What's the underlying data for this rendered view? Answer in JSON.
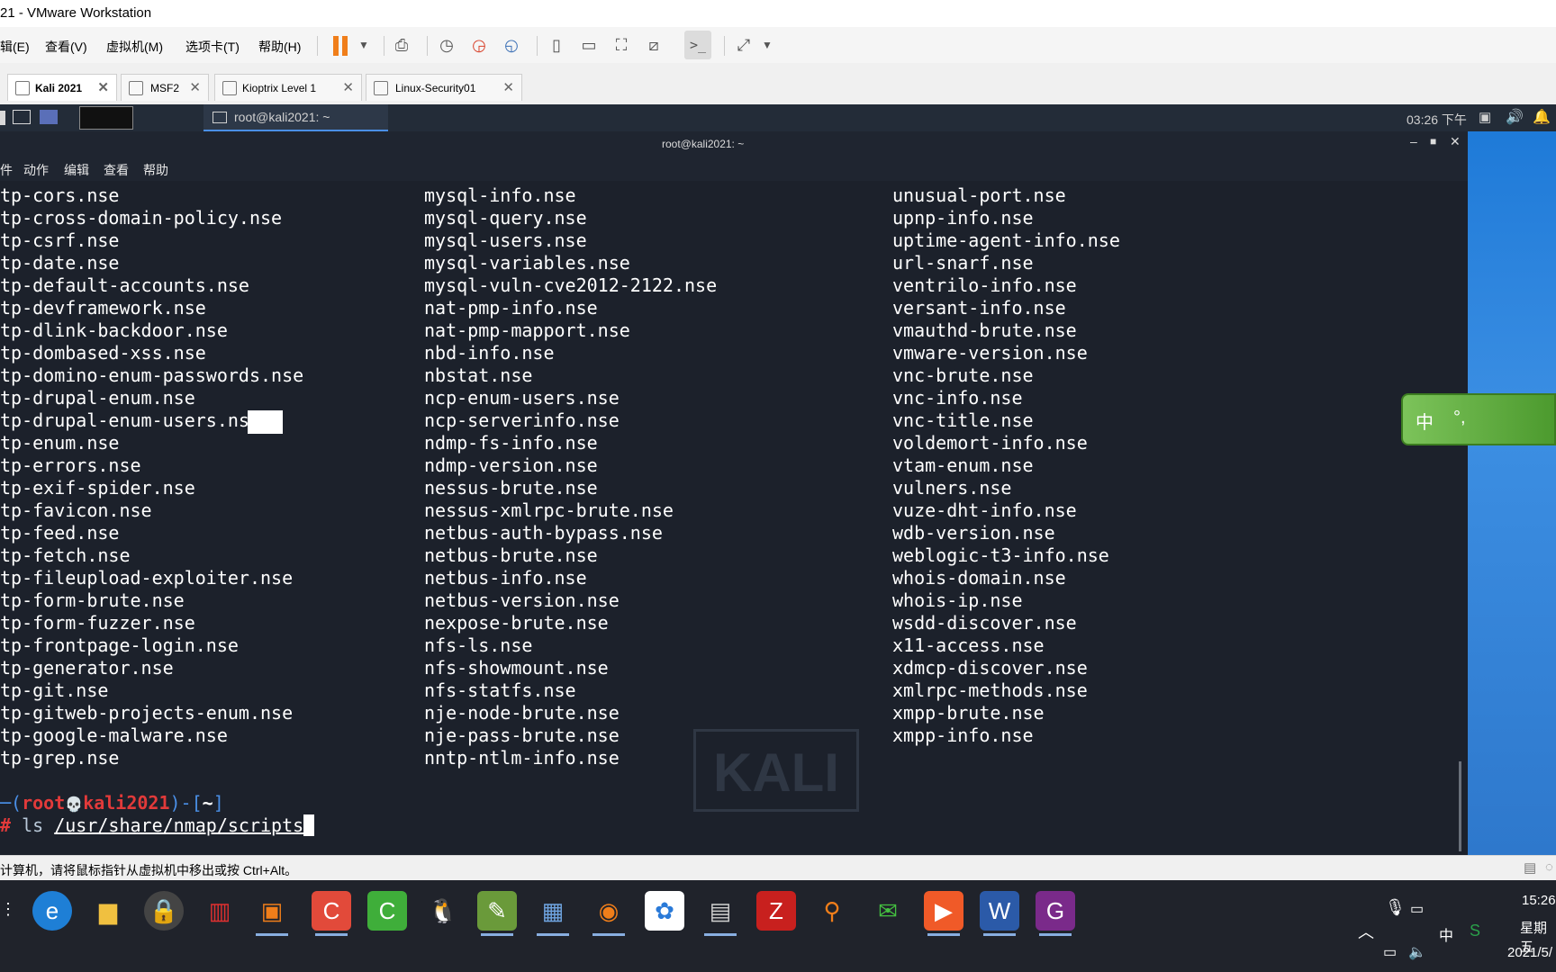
{
  "window": {
    "title": "21 - VMware Workstation"
  },
  "menu": [
    "辑(E)",
    "查看(V)",
    "虚拟机(M)",
    "选项卡(T)",
    "帮助(H)"
  ],
  "vm_tabs": [
    {
      "label": "Kali 2021",
      "active": true
    },
    {
      "label": "MSF2",
      "active": false
    },
    {
      "label": "Kioptrix Level 1",
      "active": false
    },
    {
      "label": "Linux-Security01",
      "active": false
    }
  ],
  "kali_panel": {
    "task_title": "root@kali2021: ~",
    "clock": "03:26 下午"
  },
  "terminal": {
    "title": "root@kali2021: ~",
    "menu": [
      "件",
      "动作",
      "编辑",
      "查看",
      "帮助"
    ],
    "col1": [
      "tp-cors.nse",
      "tp-cross-domain-policy.nse",
      "tp-csrf.nse",
      "tp-date.nse",
      "tp-default-accounts.nse",
      "tp-devframework.nse",
      "tp-dlink-backdoor.nse",
      "tp-dombased-xss.nse",
      "tp-domino-enum-passwords.nse",
      "tp-drupal-enum.nse",
      "tp-drupal-enum-users.nse",
      "tp-enum.nse",
      "tp-errors.nse",
      "tp-exif-spider.nse",
      "tp-favicon.nse",
      "tp-feed.nse",
      "tp-fetch.nse",
      "tp-fileupload-exploiter.nse",
      "tp-form-brute.nse",
      "tp-form-fuzzer.nse",
      "tp-frontpage-login.nse",
      "tp-generator.nse",
      "tp-git.nse",
      "tp-gitweb-projects-enum.nse",
      "tp-google-malware.nse",
      "tp-grep.nse"
    ],
    "col2": [
      "mysql-info.nse",
      "mysql-query.nse",
      "mysql-users.nse",
      "mysql-variables.nse",
      "mysql-vuln-cve2012-2122.nse",
      "nat-pmp-info.nse",
      "nat-pmp-mapport.nse",
      "nbd-info.nse",
      "nbstat.nse",
      "ncp-enum-users.nse",
      "ncp-serverinfo.nse",
      "ndmp-fs-info.nse",
      "ndmp-version.nse",
      "nessus-brute.nse",
      "nessus-xmlrpc-brute.nse",
      "netbus-auth-bypass.nse",
      "netbus-brute.nse",
      "netbus-info.nse",
      "netbus-version.nse",
      "nexpose-brute.nse",
      "nfs-ls.nse",
      "nfs-showmount.nse",
      "nfs-statfs.nse",
      "nje-node-brute.nse",
      "nje-pass-brute.nse",
      "nntp-ntlm-info.nse"
    ],
    "col3": [
      "unusual-port.nse",
      "upnp-info.nse",
      "uptime-agent-info.nse",
      "url-snarf.nse",
      "ventrilo-info.nse",
      "versant-info.nse",
      "vmauthd-brute.nse",
      "vmware-version.nse",
      "vnc-brute.nse",
      "vnc-info.nse",
      "vnc-title.nse",
      "voldemort-info.nse",
      "vtam-enum.nse",
      "vulners.nse",
      "vuze-dht-info.nse",
      "wdb-version.nse",
      "weblogic-t3-info.nse",
      "whois-domain.nse",
      "whois-ip.nse",
      "wsdd-discover.nse",
      "x11-access.nse",
      "xdmcp-discover.nse",
      "xmlrpc-methods.nse",
      "xmpp-brute.nse",
      "xmpp-info.nse"
    ],
    "prompt_open": "─(",
    "prompt_user": "root",
    "prompt_skull": "💀",
    "prompt_host": "kali2021",
    "prompt_close": ")-[",
    "prompt_dir": "~",
    "prompt_end": "]",
    "prompt_hash": "# ",
    "command_name": "ls ",
    "command_path": "/usr/share/nmap/scripts",
    "watermark": "KALI"
  },
  "ime": {
    "mode": "中",
    "punct": "°,"
  },
  "vm_status": {
    "message": "计算机，请将鼠标指针从虚拟机中移出或按 Ctrl+Alt。"
  },
  "taskbar": {
    "time": "15:26",
    "weekday": "星期五",
    "date": "2021/5/",
    "ime": "中"
  },
  "colors": {
    "terminal_bg": "#1c212b",
    "prompt_red": "#e23a3a",
    "prompt_blue": "#4a8fe6",
    "accent_orange": "#f07e1a"
  }
}
